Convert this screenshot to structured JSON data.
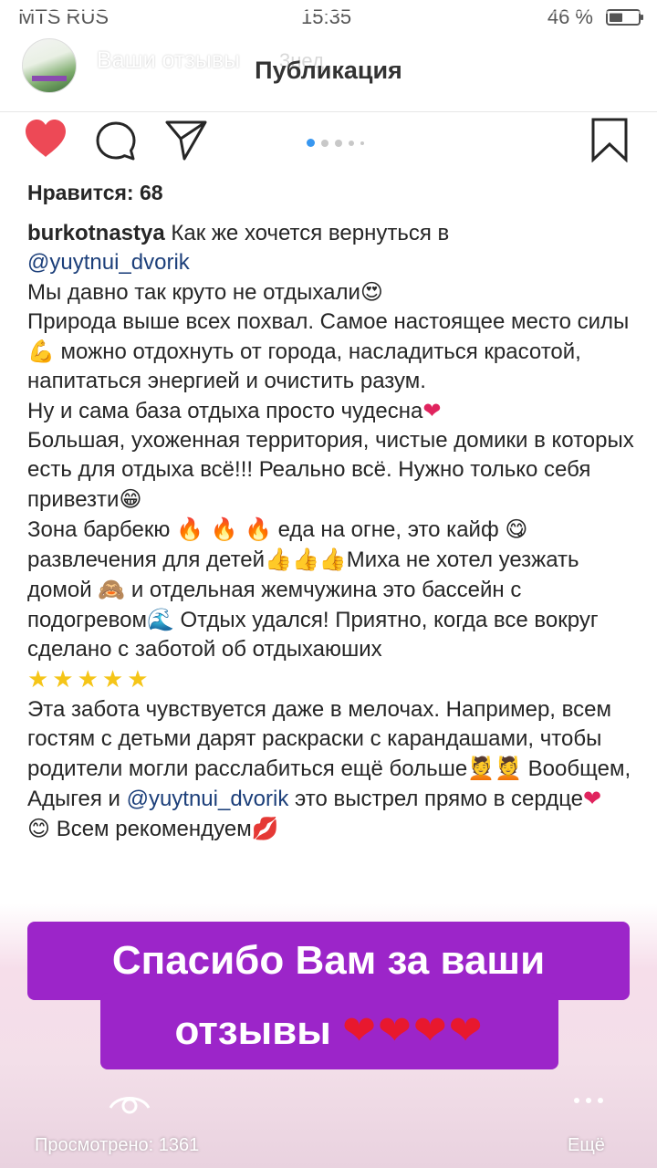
{
  "status_bar": {
    "carrier": "MTS RUS",
    "time": "15:35",
    "battery": "46 %"
  },
  "story_header": {
    "user": "Ваши отзывы",
    "time_ago": "3нед",
    "title": "Публикация"
  },
  "post": {
    "likes": "Нравится: 68",
    "author": "burkotnastya",
    "caption_lines": {
      "l1": "Как же хочется вернуться в",
      "l1_mention": "@yuytnui_dvorik",
      "l2": "Мы давно так круто не отдыхали",
      "l3": "Природа выше всех похвал. Самое настоящее место силы",
      "l3b": " можно отдохнуть от города, насладиться красотой, напитаться энергией и очистить разум.",
      "l4": "Ну и сама база отдыха просто чудесна",
      "l5": "Большая, ухоженная территория, чистые домики в которых есть для отдыха всё!!! Реально всё. Нужно только себя привезти",
      "l6a": "Зона барбекю",
      "l6b": " еда на огне, это кайф ",
      "l6c": "развлечения для детей",
      "l6d": "Миха не хотел уезжать домой ",
      "l6e": " и отдельная жемчужина это бассейн с подогревом",
      "l6f": " Отдых удался! Приятно, когда все вокруг сделано с заботой об отдыхаюших",
      "l7": "Эта забота чувствуется даже в мелочах. Например, всем гостям с детьми дарят раскраски с карандашами, чтобы родители могли расслабиться ещё больше",
      "l7b": " Вообщем, Адыгея и ",
      "l7_mention": "@yuytnui_dvorik",
      "l7c": " это выстрел прямо в сердце",
      "l8": " Всем рекомендуем"
    },
    "emoji": {
      "heart_eyes": "😍",
      "muscle": "💪",
      "heart": "❤",
      "grin": "😁",
      "fire3": "🔥 🔥 🔥",
      "yum": "😋",
      "thumbs3": "👍👍👍",
      "monkey": "🙈",
      "pool": "🌊",
      "stars": "★★★★★",
      "spa": "💆💆",
      "smile": "😊",
      "kiss": "💋"
    }
  },
  "banner": {
    "line1": "Спасибо Вам за ваши",
    "line2": "отзывы",
    "hearts": "❤❤❤❤"
  },
  "footer": {
    "views": "Просмотрено: 1361",
    "more": "Ещё"
  }
}
